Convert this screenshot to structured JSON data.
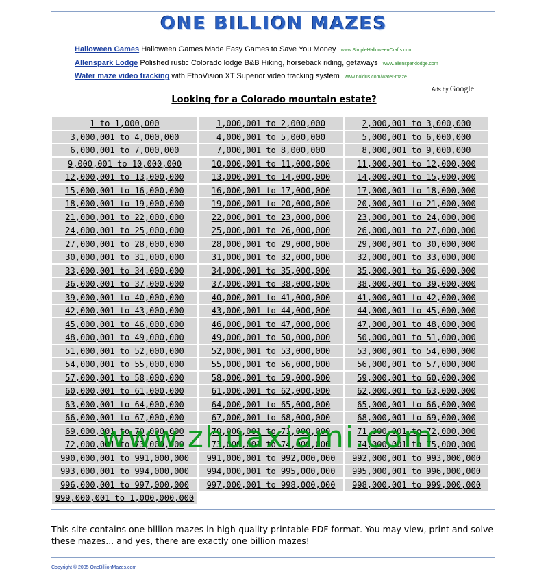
{
  "site": {
    "logo_text": "ONE BILLION MAZES",
    "heading": "Looking for a Colorado mountain estate?",
    "info_text": "This site contains one billion mazes in high-quality printable PDF format. You may view, print and solve these mazes... and yes, there are exactly one billion mazes!",
    "copyright": "Copyright © 2005 OneBillionMazes.com",
    "watermark": "www.zhuaxiami.com"
  },
  "ads": [
    {
      "title": "Halloween Games",
      "desc": "Halloween Games Made Easy Games to Save You Money",
      "url": "www.SimpleHalloweenCrafts.com"
    },
    {
      "title": "Allenspark Lodge",
      "desc": "Polished rustic Colorado lodge B&B Hiking, horseback riding, getaways",
      "url": "www.allensparklodge.com"
    },
    {
      "title": "Water maze video tracking",
      "desc": "with EthoVision XT Superior video tracking system",
      "url": "www.noldus.com/water-maze"
    }
  ],
  "ads_by": {
    "label": "Ads by",
    "brand": "Google"
  },
  "ranges": [
    [
      "1 to 1,000,000",
      "1,000,001 to 2,000,000",
      "2,000,001 to 3,000,000"
    ],
    [
      "3,000,001 to 4,000,000",
      "4,000,001 to 5,000,000",
      "5,000,001 to 6,000,000"
    ],
    [
      "6,000,001 to 7,000,000",
      "7,000,001 to 8,000,000",
      "8,000,001 to 9,000,000"
    ],
    [
      "9,000,001 to 10,000,000",
      "10,000,001 to 11,000,000",
      "11,000,001 to 12,000,000"
    ],
    [
      "12,000,001 to 13,000,000",
      "13,000,001 to 14,000,000",
      "14,000,001 to 15,000,000"
    ],
    [
      "15,000,001 to 16,000,000",
      "16,000,001 to 17,000,000",
      "17,000,001 to 18,000,000"
    ],
    [
      "18,000,001 to 19,000,000",
      "19,000,001 to 20,000,000",
      "20,000,001 to 21,000,000"
    ],
    [
      "21,000,001 to 22,000,000",
      "22,000,001 to 23,000,000",
      "23,000,001 to 24,000,000"
    ],
    [
      "24,000,001 to 25,000,000",
      "25,000,001 to 26,000,000",
      "26,000,001 to 27,000,000"
    ],
    [
      "27,000,001 to 28,000,000",
      "28,000,001 to 29,000,000",
      "29,000,001 to 30,000,000"
    ],
    [
      "30,000,001 to 31,000,000",
      "31,000,001 to 32,000,000",
      "32,000,001 to 33,000,000"
    ],
    [
      "33,000,001 to 34,000,000",
      "34,000,001 to 35,000,000",
      "35,000,001 to 36,000,000"
    ],
    [
      "36,000,001 to 37,000,000",
      "37,000,001 to 38,000,000",
      "38,000,001 to 39,000,000"
    ],
    [
      "39,000,001 to 40,000,000",
      "40,000,001 to 41,000,000",
      "41,000,001 to 42,000,000"
    ],
    [
      "42,000,001 to 43,000,000",
      "43,000,001 to 44,000,000",
      "44,000,001 to 45,000,000"
    ],
    [
      "45,000,001 to 46,000,000",
      "46,000,001 to 47,000,000",
      "47,000,001 to 48,000,000"
    ],
    [
      "48,000,001 to 49,000,000",
      "49,000,001 to 50,000,000",
      "50,000,001 to 51,000,000"
    ],
    [
      "51,000,001 to 52,000,000",
      "52,000,001 to 53,000,000",
      "53,000,001 to 54,000,000"
    ],
    [
      "54,000,001 to 55,000,000",
      "55,000,001 to 56,000,000",
      "56,000,001 to 57,000,000"
    ],
    [
      "57,000,001 to 58,000,000",
      "58,000,001 to 59,000,000",
      "59,000,001 to 60,000,000"
    ],
    [
      "60,000,001 to 61,000,000",
      "61,000,001 to 62,000,000",
      "62,000,001 to 63,000,000"
    ],
    [
      "63,000,001 to 64,000,000",
      "64,000,001 to 65,000,000",
      "65,000,001 to 66,000,000"
    ],
    [
      "66,000,001 to 67,000,000",
      "67,000,001 to 68,000,000",
      "68,000,001 to 69,000,000"
    ],
    [
      "69,000,001 to 70,000,000",
      "70,000,001 to 71,000,000",
      "71,000,001 to 72,000,000"
    ],
    [
      "72,000,001 to 73,000,000",
      "73,000,001 to 74,000,000",
      "74,000,001 to 75,000,000"
    ],
    [
      "990,000,001 to 991,000,000",
      "991,000,001 to 992,000,000",
      "992,000,001 to 993,000,000"
    ],
    [
      "993,000,001 to 994,000,000",
      "994,000,001 to 995,000,000",
      "995,000,001 to 996,000,000"
    ],
    [
      "996,000,001 to 997,000,000",
      "997,000,001 to 998,000,000",
      "998,000,001 to 999,000,000"
    ],
    [
      "999,000,001 to 1,000,000,000"
    ]
  ]
}
